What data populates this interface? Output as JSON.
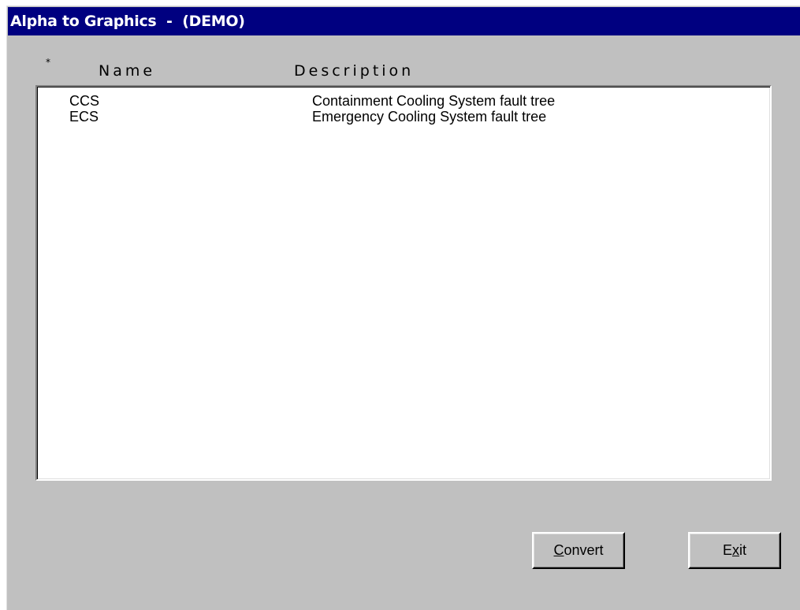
{
  "window": {
    "title": "Alpha to Graphics  -  (DEMO)"
  },
  "columns": {
    "mark": "*",
    "name": "Name",
    "description": "Description"
  },
  "list": {
    "rows": [
      {
        "name": "CCS",
        "description": "Containment Cooling System fault tree"
      },
      {
        "name": "ECS",
        "description": "Emergency Cooling System fault tree"
      }
    ]
  },
  "buttons": {
    "convert": {
      "label": "Convert",
      "mnemonic": "C"
    },
    "exit": {
      "label": "Exit",
      "mnemonic": "x"
    }
  },
  "colors": {
    "titlebar": "#000080",
    "face": "#c0c0c0"
  }
}
